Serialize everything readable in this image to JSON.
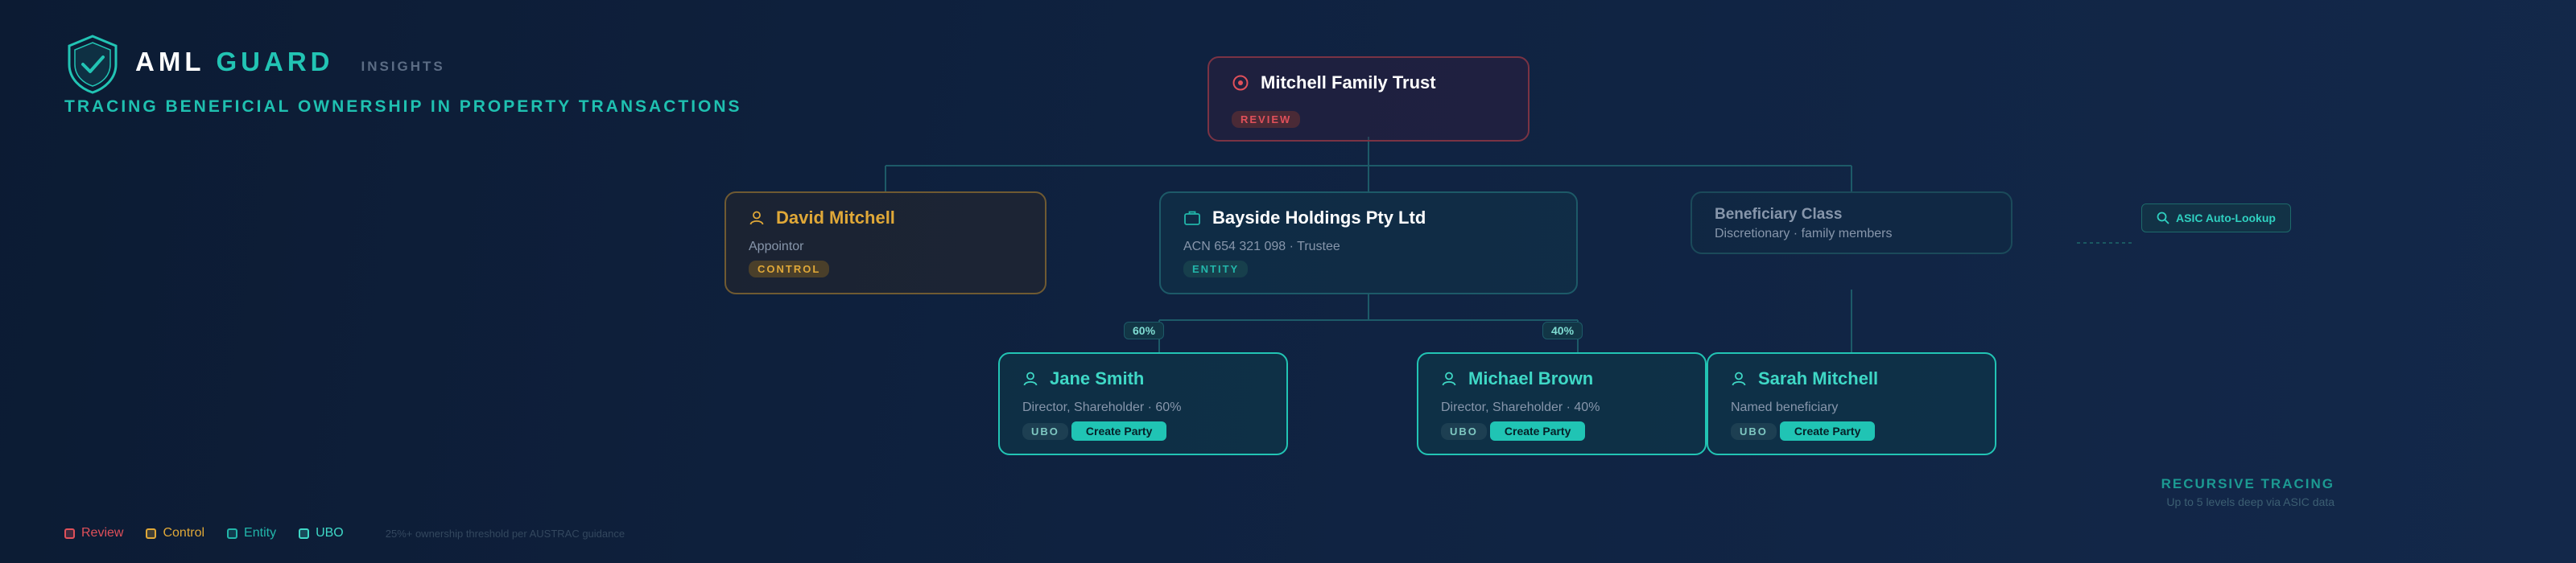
{
  "header": {
    "brand_part1": "AML",
    "brand_part2": "GUARD",
    "brand_suffix": "INSIGHTS",
    "tagline": "TRACING BENEFICIAL OWNERSHIP IN PROPERTY TRANSACTIONS",
    "logo_icon": "shield-check-icon"
  },
  "nodes": {
    "root": {
      "title": "Mitchell Family Trust",
      "badge": "REVIEW",
      "icon": "target-icon"
    },
    "david": {
      "title": "David Mitchell",
      "sub": "Appointor",
      "badge": "CONTROL",
      "icon": "person-icon"
    },
    "bayside": {
      "title": "Bayside Holdings Pty Ltd",
      "sub": "ACN 654 321 098 · Trustee",
      "badge": "ENTITY",
      "icon": "briefcase-icon"
    },
    "beneficiary": {
      "title": "Beneficiary Class",
      "sub": "Discretionary · family members"
    },
    "jane": {
      "title": "Jane Smith",
      "sub": "Director, Shareholder · 60%",
      "badge": "UBO",
      "button": "Create Party",
      "icon": "person-icon"
    },
    "michael": {
      "title": "Michael Brown",
      "sub": "Director, Shareholder · 40%",
      "badge": "UBO",
      "button": "Create Party",
      "icon": "person-icon"
    },
    "sarah": {
      "title": "Sarah Mitchell",
      "sub": "Named beneficiary",
      "badge": "UBO",
      "button": "Create Party",
      "icon": "person-icon"
    }
  },
  "edges": {
    "jane_pct": "60%",
    "michael_pct": "40%"
  },
  "asic": {
    "label": "ASIC Auto-Lookup",
    "icon": "search-icon"
  },
  "recursive": {
    "title": "RECURSIVE TRACING",
    "sub": "Up to 5 levels deep via ASIC data"
  },
  "legend": {
    "items": [
      {
        "label": "Review",
        "color": "#e0505a"
      },
      {
        "label": "Control",
        "color": "#e0a838"
      },
      {
        "label": "Entity",
        "color": "#22b6aa"
      },
      {
        "label": "UBO",
        "color": "#3fd8c6"
      }
    ],
    "note": "25%+ ownership threshold per AUSTRAC guidance"
  },
  "colors": {
    "accent": "#22c4b4",
    "review": "#e0505a",
    "control": "#e0a838"
  }
}
